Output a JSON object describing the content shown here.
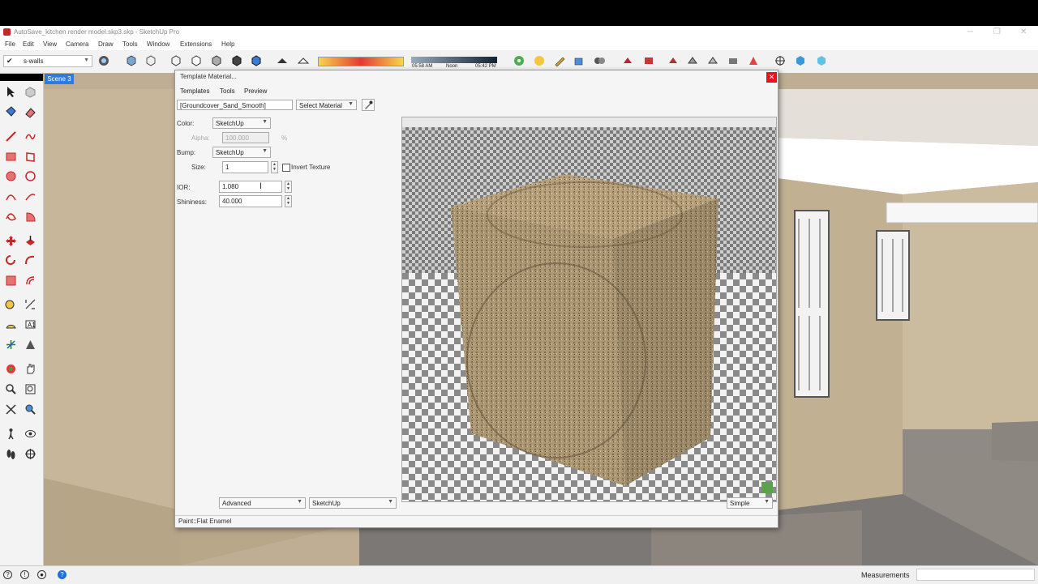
{
  "window": {
    "title": "AutoSave_kitchen render model.skp3.skp - SketchUp Pro"
  },
  "menu": [
    "File",
    "Edit",
    "View",
    "Camera",
    "Draw",
    "Tools",
    "Window",
    "Extensions",
    "Help"
  ],
  "toolbar": {
    "layer_value": "s-walls",
    "time_left": "05:58 AM",
    "noon": "Noon",
    "time_right": "05:42 PM"
  },
  "scene_tab": "Scene 3",
  "dialog": {
    "title": "Template Material...",
    "menu": [
      "Templates",
      "Tools",
      "Preview"
    ],
    "material_name": "[Groundcover_Sand_Smooth]",
    "select_material": "Select Material",
    "color_label": "Color:",
    "color_value": "SketchUp",
    "alpha_label": "Alpha:",
    "alpha_value": "100.000",
    "alpha_unit": "%",
    "bump_label": "Bump:",
    "bump_value": "SketchUp",
    "size_label": "Size:",
    "size_value": "1",
    "invert_label": "Invert Texture",
    "ior_label": "IOR:",
    "ior_value": "1.080",
    "shininess_label": "Shininess:",
    "shininess_value": "40.000",
    "mode_left": "Advanced",
    "mode_right": "SketchUp",
    "preview_mode": "Simple",
    "status_text": "Paint::Flat Enamel"
  },
  "statusbar": {
    "measurements_label": "Measurements"
  }
}
